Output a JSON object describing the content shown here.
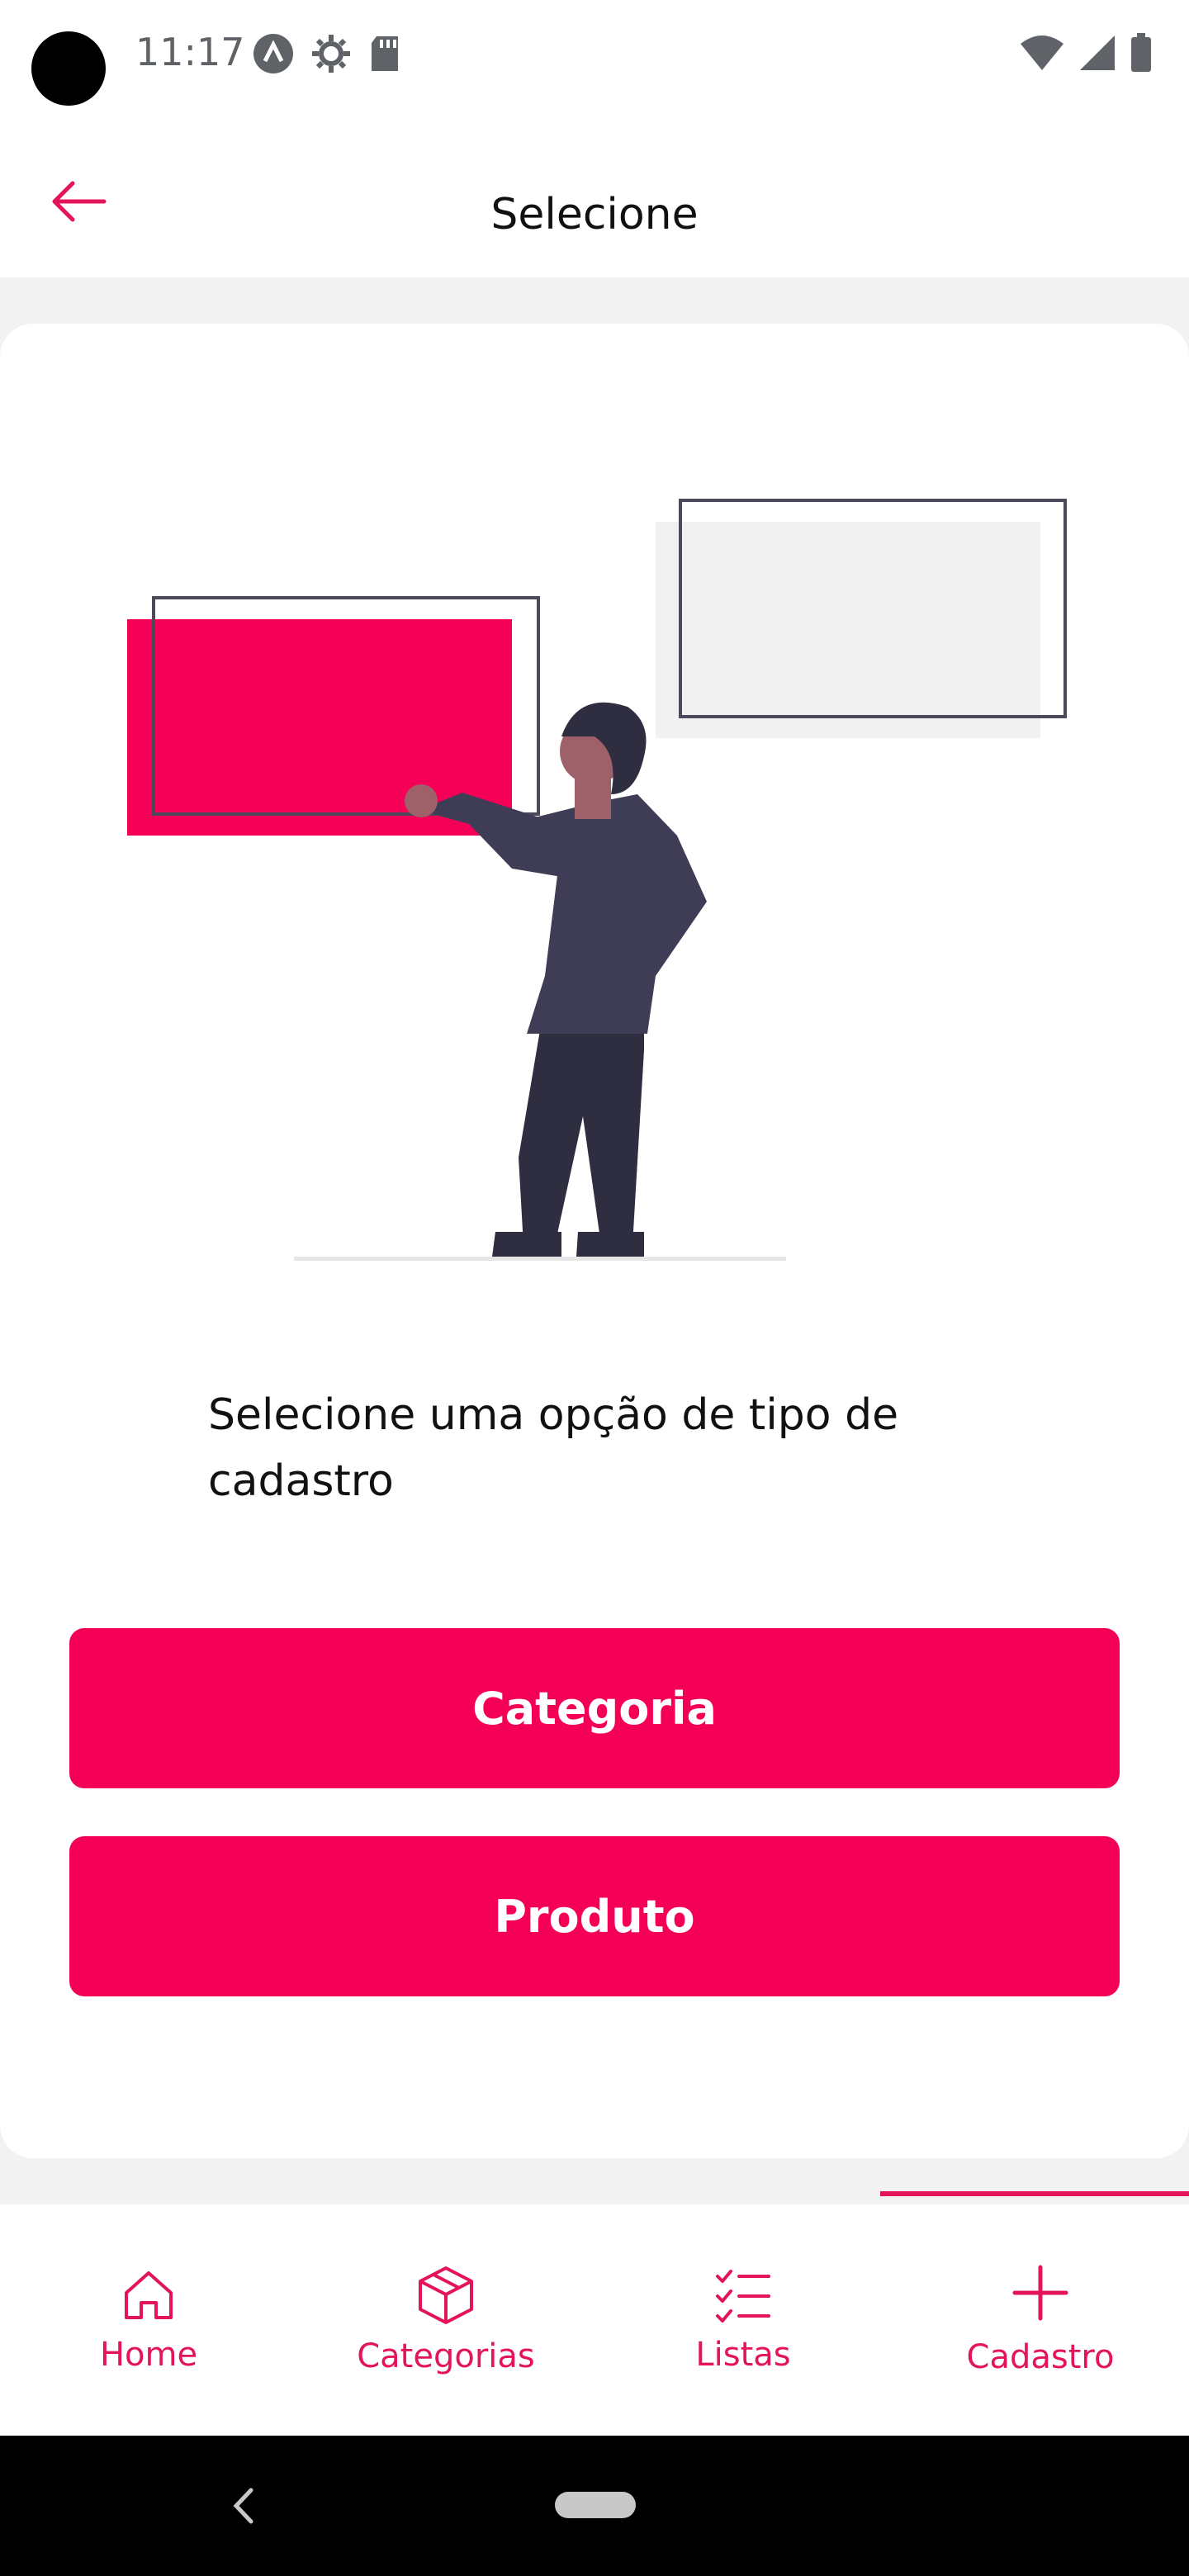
{
  "status": {
    "time": "11:17",
    "left_icons": [
      "app-icon",
      "settings-icon",
      "sd-card-icon"
    ],
    "right_icons": [
      "wifi-icon",
      "signal-icon",
      "battery-icon"
    ]
  },
  "appbar": {
    "title": "Selecione",
    "back_icon": "arrow-left-icon"
  },
  "main": {
    "prompt": "Selecione uma opção de tipo de cadastro",
    "buttons": [
      {
        "label": "Categoria"
      },
      {
        "label": "Produto"
      }
    ],
    "accent_color": "#f50057"
  },
  "bottom_nav": {
    "items": [
      {
        "label": "Home",
        "icon": "home-icon"
      },
      {
        "label": "Categorias",
        "icon": "box-icon"
      },
      {
        "label": "Listas",
        "icon": "checklist-icon"
      },
      {
        "label": "Cadastro",
        "icon": "plus-icon",
        "selected": true
      }
    ],
    "color": "#e4145a"
  }
}
